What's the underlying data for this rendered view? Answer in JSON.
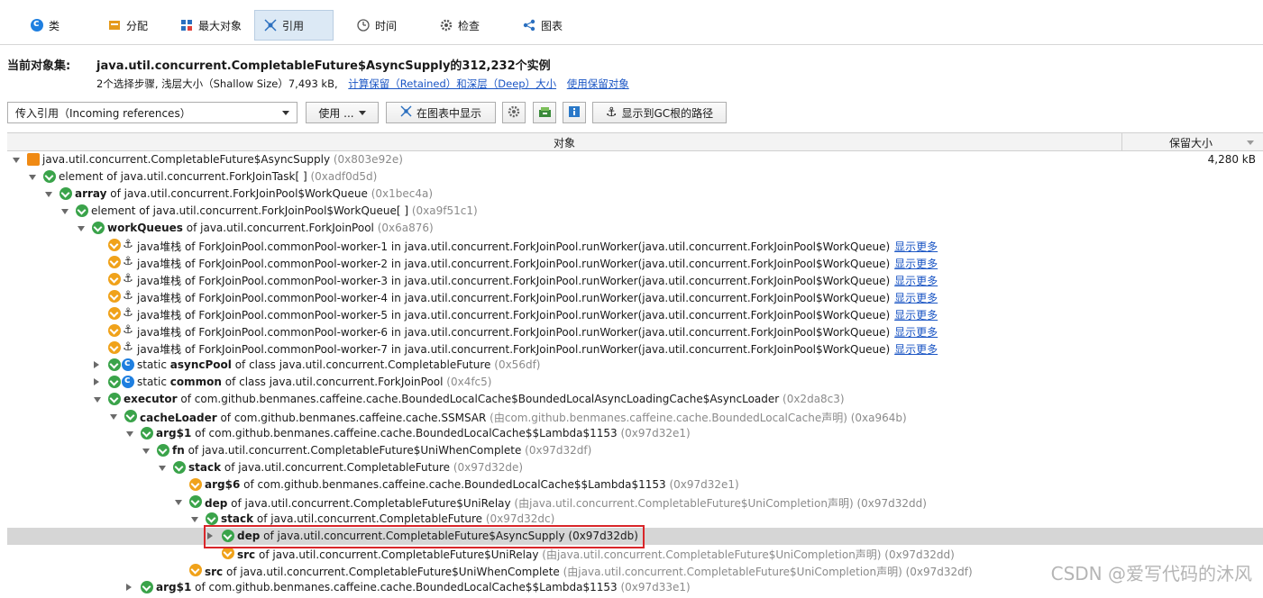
{
  "tabs": [
    {
      "label": "类",
      "icon": "class-icon"
    },
    {
      "label": "分配",
      "icon": "allocation-icon"
    },
    {
      "label": "最大对象",
      "icon": "biggest-objects-icon"
    },
    {
      "label": "引用",
      "icon": "references-icon"
    },
    {
      "label": "时间",
      "icon": "time-icon"
    },
    {
      "label": "检查",
      "icon": "inspect-icon"
    },
    {
      "label": "图表",
      "icon": "graph-icon"
    }
  ],
  "header": {
    "label": "当前对象集:",
    "title": "java.util.concurrent.CompletableFuture$AsyncSupply的312,232个实例",
    "sub_text": "2个选择步骤, 浅层大小（Shallow Size）7,493 kB,",
    "link_retained": "计算保留（Retained）和深层（Deep）大小",
    "link_use_retained": "使用保留对象"
  },
  "toolbar": {
    "select_value": "传入引用（Incoming references）",
    "use_label": "使用 ...",
    "show_in_graph_label": "在图表中显示",
    "gc_root_label": "显示到GC根的路径"
  },
  "table": {
    "col_object": "对象",
    "col_retained": "保留大小",
    "rows": [
      {
        "name": "",
        "rest": "java.util.concurrent.CompletableFuture$AsyncSupply",
        "addr": "(0x803e92e)",
        "retained": "4,280 kB"
      },
      {
        "name": "",
        "rest": "element of java.util.concurrent.ForkJoinTask[ ]",
        "addr": "(0xadf0d5d)"
      },
      {
        "name": "array",
        "rest": " of java.util.concurrent.ForkJoinPool$WorkQueue",
        "addr": "(0x1bec4a)"
      },
      {
        "name": "",
        "rest": "element of java.util.concurrent.ForkJoinPool$WorkQueue[ ]",
        "addr": "(0xa9f51c1)"
      },
      {
        "name": "workQueues",
        "rest": " of java.util.concurrent.ForkJoinPool",
        "addr": "(0x6a876)"
      },
      {
        "name": "",
        "rest": "java堆栈 of ForkJoinPool.commonPool-worker-1 in java.util.concurrent.ForkJoinPool.runWorker(java.util.concurrent.ForkJoinPool$WorkQueue)",
        "addr": "",
        "more": "显示更多"
      },
      {
        "name": "",
        "rest": "java堆栈 of ForkJoinPool.commonPool-worker-2 in java.util.concurrent.ForkJoinPool.runWorker(java.util.concurrent.ForkJoinPool$WorkQueue)",
        "addr": "",
        "more": "显示更多"
      },
      {
        "name": "",
        "rest": "java堆栈 of ForkJoinPool.commonPool-worker-3 in java.util.concurrent.ForkJoinPool.runWorker(java.util.concurrent.ForkJoinPool$WorkQueue)",
        "addr": "",
        "more": "显示更多"
      },
      {
        "name": "",
        "rest": "java堆栈 of ForkJoinPool.commonPool-worker-4 in java.util.concurrent.ForkJoinPool.runWorker(java.util.concurrent.ForkJoinPool$WorkQueue)",
        "addr": "",
        "more": "显示更多"
      },
      {
        "name": "",
        "rest": "java堆栈 of ForkJoinPool.commonPool-worker-5 in java.util.concurrent.ForkJoinPool.runWorker(java.util.concurrent.ForkJoinPool$WorkQueue)",
        "addr": "",
        "more": "显示更多"
      },
      {
        "name": "",
        "rest": "java堆栈 of ForkJoinPool.commonPool-worker-6 in java.util.concurrent.ForkJoinPool.runWorker(java.util.concurrent.ForkJoinPool$WorkQueue)",
        "addr": "",
        "more": "显示更多"
      },
      {
        "name": "",
        "rest": "java堆栈 of ForkJoinPool.commonPool-worker-7 in java.util.concurrent.ForkJoinPool.runWorker(java.util.concurrent.ForkJoinPool$WorkQueue)",
        "addr": "",
        "more": "显示更多"
      },
      {
        "pre": "static ",
        "name": "asyncPool",
        "rest": " of class java.util.concurrent.CompletableFuture",
        "addr": "(0x56df)"
      },
      {
        "pre": "static ",
        "name": "common",
        "rest": " of class java.util.concurrent.ForkJoinPool",
        "addr": "(0x4fc5)"
      },
      {
        "name": "executor",
        "rest": " of com.github.benmanes.caffeine.cache.BoundedLocalCache$BoundedLocalAsyncLoadingCache$AsyncLoader",
        "addr": "(0x2da8c3)"
      },
      {
        "name": "cacheLoader",
        "rest": " of com.github.benmanes.caffeine.cache.SSMSAR",
        "addr": "(由com.github.benmanes.caffeine.cache.BoundedLocalCache声明) (0xa964b)"
      },
      {
        "name": "arg$1",
        "rest": " of com.github.benmanes.caffeine.cache.BoundedLocalCache$$Lambda$1153",
        "addr": "(0x97d32e1)"
      },
      {
        "name": "fn",
        "rest": " of java.util.concurrent.CompletableFuture$UniWhenComplete",
        "addr": "(0x97d32df)"
      },
      {
        "name": "stack",
        "rest": " of java.util.concurrent.CompletableFuture",
        "addr": "(0x97d32de)"
      },
      {
        "name": "arg$6",
        "rest": " of com.github.benmanes.caffeine.cache.BoundedLocalCache$$Lambda$1153",
        "addr": "(0x97d32e1)"
      },
      {
        "name": "dep",
        "rest": " of java.util.concurrent.CompletableFuture$UniRelay",
        "addr": "(由java.util.concurrent.CompletableFuture$UniCompletion声明) (0x97d32dd)"
      },
      {
        "name": "stack",
        "rest": " of java.util.concurrent.CompletableFuture",
        "addr": "(0x97d32dc)"
      },
      {
        "name": "dep",
        "rest": " of java.util.concurrent.CompletableFuture$AsyncSupply (0x97d32db)",
        "addr": ""
      },
      {
        "name": "src",
        "rest": " of java.util.concurrent.CompletableFuture$UniRelay",
        "addr": "(由java.util.concurrent.CompletableFuture$UniCompletion声明) (0x97d32dd)"
      },
      {
        "name": "src",
        "rest": " of java.util.concurrent.CompletableFuture$UniWhenComplete",
        "addr": "(由java.util.concurrent.CompletableFuture$UniCompletion声明) (0x97d32df)"
      },
      {
        "name": "arg$1",
        "rest": " of com.github.benmanes.caffeine.cache.BoundedLocalCache$$Lambda$1153",
        "addr": "(0x97d33e1)"
      }
    ]
  },
  "watermark": "CSDN @爱写代码的沐风"
}
